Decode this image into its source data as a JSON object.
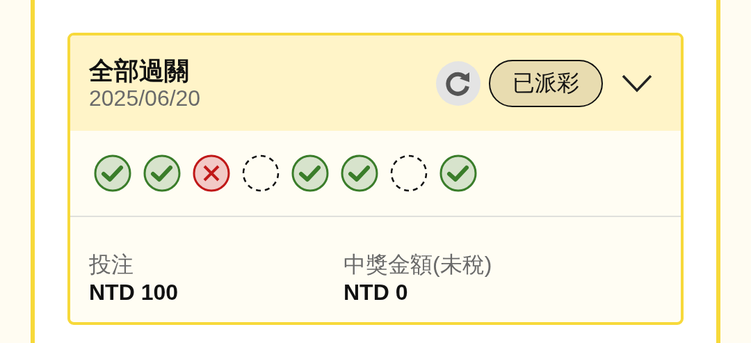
{
  "bet": {
    "title": "全部過關",
    "date": "2025/06/20",
    "status": "已派彩",
    "expanded": false,
    "results": [
      {
        "kind": "win"
      },
      {
        "kind": "win"
      },
      {
        "kind": "loss"
      },
      {
        "kind": "pending"
      },
      {
        "kind": "win"
      },
      {
        "kind": "win"
      },
      {
        "kind": "pending"
      },
      {
        "kind": "win"
      }
    ],
    "amounts": [
      {
        "label": "投注",
        "value": "NTD 100"
      },
      {
        "label": "中獎金額(未稅)",
        "value": "NTD 0"
      }
    ]
  }
}
